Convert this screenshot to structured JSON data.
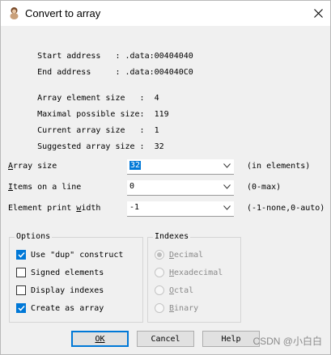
{
  "window": {
    "title": "Convert to array"
  },
  "info": {
    "start_address_label": "Start address   :",
    "start_address_value": " .data:00404040",
    "end_address_label": "End address     :",
    "end_address_value": " .data:004040C0",
    "array_element_size_label": "Array element size   :",
    "array_element_size_value": "  4",
    "maximal_possible_size_label": "Maximal possible size:",
    "maximal_possible_size_value": "  119",
    "current_array_size_label": "Current array size   :",
    "current_array_size_value": "  1",
    "suggested_array_size_label": "Suggested array size :",
    "suggested_array_size_value": "  32"
  },
  "fields": {
    "array_size": {
      "label_pre": "",
      "label_ul": "A",
      "label_post": "rray size",
      "value": "32",
      "hint": "(in elements)"
    },
    "items_on_line": {
      "label_pre": "",
      "label_ul": "I",
      "label_post": "tems on a line",
      "value": "0",
      "hint": "(0-max)"
    },
    "element_print_width": {
      "label_pre": "Element print ",
      "label_ul": "w",
      "label_post": "idth",
      "value": "-1",
      "hint": "(-1-none,0-auto)"
    }
  },
  "options": {
    "title": "Options",
    "use_dup": {
      "label": "Use \"dup\" construct",
      "checked": true
    },
    "signed_elements": {
      "label": "Signed elements",
      "checked": false
    },
    "display_indexes": {
      "label": "Display indexes",
      "checked": false
    },
    "create_as_array": {
      "label": "Create as array",
      "checked": true
    }
  },
  "indexes": {
    "title": "Indexes",
    "decimal": {
      "label": "Decimal",
      "selected": true
    },
    "hexadecimal": {
      "label": "Hexadecimal",
      "selected": false
    },
    "octal": {
      "label": "Octal",
      "selected": false
    },
    "binary": {
      "label": "Binary",
      "selected": false
    }
  },
  "buttons": {
    "ok": "OK",
    "cancel": "Cancel",
    "help": "Help"
  },
  "watermark": "CSDN @小白白",
  "colors": {
    "accent": "#0078d7",
    "dialog_bg": "#f0f0f0"
  }
}
